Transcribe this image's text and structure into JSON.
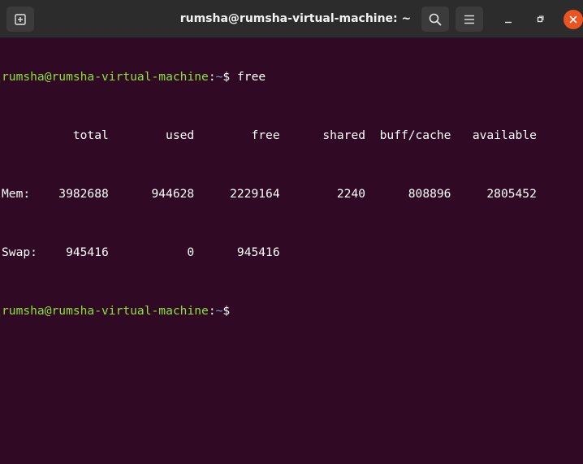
{
  "window": {
    "title": "rumsha@rumsha-virtual-machine: ~",
    "accent_close": "#e95420",
    "background": "#300a24"
  },
  "toolbar": {
    "new_tab_icon": "new-tab-icon",
    "search_icon": "search-icon",
    "menu_icon": "hamburger-menu-icon",
    "minimize_icon": "minimize-icon",
    "maximize_icon": "maximize-icon",
    "close_icon": "close-icon"
  },
  "prompt": {
    "user_host": "rumsha@rumsha-virtual-machine",
    "separator": ":",
    "path": "~",
    "symbol": "$"
  },
  "command": "free",
  "table": {
    "headers": [
      "total",
      "used",
      "free",
      "shared",
      "buff/cache",
      "available"
    ],
    "rows": [
      {
        "label": "Mem:",
        "values": [
          "3982688",
          "944628",
          "2229164",
          "2240",
          "808896",
          "2805452"
        ]
      },
      {
        "label": "Swap:",
        "values": [
          "945416",
          "0",
          "945416"
        ]
      }
    ]
  },
  "colors": {
    "prompt_user": "#8ae234",
    "prompt_path": "#729fcf",
    "text": "#ffffff"
  }
}
